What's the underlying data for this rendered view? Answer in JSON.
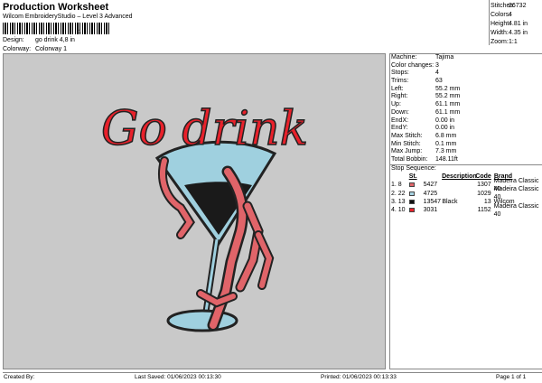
{
  "header": {
    "title": "Production Worksheet",
    "subtitle": "Wilcom EmbroideryStudio – Level 3 Advanced",
    "barcode_mark": ",1"
  },
  "design": {
    "label": "Design:",
    "value": "go drink 4,8 in"
  },
  "colorway": {
    "label": "Colorway:",
    "value": "Colorway 1"
  },
  "stats": [
    {
      "k": "Stitches:",
      "v": "26732"
    },
    {
      "k": "Colors:",
      "v": "4"
    },
    {
      "k": "Height:",
      "v": "4.81 in"
    },
    {
      "k": "Width:",
      "v": "4.35 in"
    },
    {
      "k": "Zoom:",
      "v": "1:1"
    }
  ],
  "artwork": {
    "text": "Go drink"
  },
  "machine_info": [
    {
      "k": "Machine:",
      "v": "Tajima"
    },
    {
      "k": "Color changes:",
      "v": "3"
    },
    {
      "k": "Stops:",
      "v": "4"
    },
    {
      "k": "Trims:",
      "v": "63"
    },
    {
      "k": "Left:",
      "v": "55.2 mm"
    },
    {
      "k": "Right:",
      "v": "55.2 mm"
    },
    {
      "k": "Up:",
      "v": "61.1 mm"
    },
    {
      "k": "Down:",
      "v": "61.1 mm"
    },
    {
      "k": "EndX:",
      "v": "0.00 in"
    },
    {
      "k": "EndY:",
      "v": "0.00 in"
    },
    {
      "k": "Max Stitch:",
      "v": "6.8 mm"
    },
    {
      "k": "Min Stitch:",
      "v": "0.1 mm"
    },
    {
      "k": "Max Jump:",
      "v": "7.3 mm"
    },
    {
      "k": "Total Bobbin:",
      "v": "148.11ft"
    }
  ],
  "stop_sequence": {
    "title": "Stop Sequence:",
    "headers": {
      "st": "St.",
      "desc": "Description",
      "code": "Code",
      "brand": "Brand"
    },
    "rows": [
      {
        "num": "1.  8",
        "color": "#e06469",
        "stitches": "5427",
        "desc": "",
        "code": "1307",
        "brand": "Madeira Classic 40"
      },
      {
        "num": "2.  22",
        "color": "#a7d3e2",
        "stitches": "4725",
        "desc": "",
        "code": "1029",
        "brand": "Madeira Classic 40"
      },
      {
        "num": "3.  13",
        "color": "#111111",
        "stitches": "13547",
        "desc": "Black",
        "code": "13",
        "brand": "Wilcom"
      },
      {
        "num": "4.  10",
        "color": "#e8212b",
        "stitches": "3031",
        "desc": "",
        "code": "1152",
        "brand": "Madeira Classic 40"
      }
    ]
  },
  "footer": {
    "created_by": "Created By:",
    "last_saved": "Last Saved: 01/06/2023 00:13:30",
    "printed": "Printed: 01/06/2023 00:13:33",
    "page": "Page 1 of 1"
  }
}
